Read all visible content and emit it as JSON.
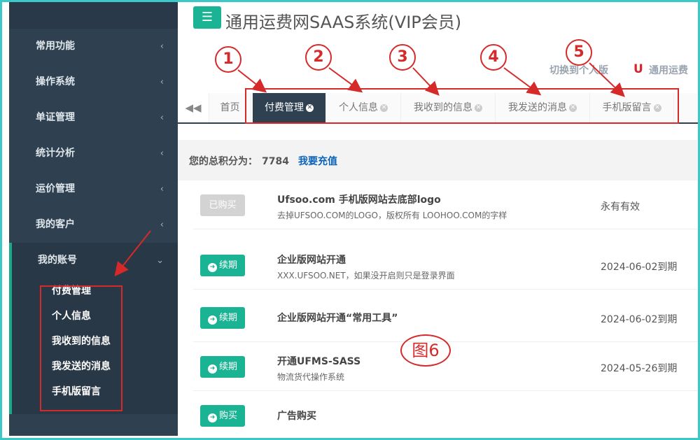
{
  "app": {
    "title": "通用运费网SAAS系统(VIP会员)",
    "switch_link": "切换到个人版",
    "general_link": "通用运费"
  },
  "sidebar": {
    "items": [
      {
        "label": "常用功能"
      },
      {
        "label": "操作系统"
      },
      {
        "label": "单证管理"
      },
      {
        "label": "统计分析"
      },
      {
        "label": "运价管理"
      },
      {
        "label": "我的客户"
      }
    ],
    "open_item": {
      "label": "我的账号"
    },
    "subitems": [
      {
        "label": "付费管理"
      },
      {
        "label": "个人信息"
      },
      {
        "label": "我收到的信息"
      },
      {
        "label": "我发送的消息"
      },
      {
        "label": "手机版留言"
      }
    ]
  },
  "tabs": {
    "home": "首页",
    "items": [
      {
        "label": "付费管理",
        "active": true
      },
      {
        "label": "个人信息",
        "active": false
      },
      {
        "label": "我收到的信息",
        "active": false
      },
      {
        "label": "我发送的消息",
        "active": false
      },
      {
        "label": "手机版留言",
        "active": false
      }
    ]
  },
  "annotations": {
    "numbers": [
      "1",
      "2",
      "3",
      "4",
      "5"
    ],
    "figure": "图6"
  },
  "content": {
    "points_label": "您的总积分为：",
    "points_value": "7784",
    "recharge": "我要充值",
    "rows": [
      {
        "button": "已购买",
        "button_icon": "",
        "title": "Ufsoo.com 手机版网站去底部logo",
        "desc": "去掉UFSOO.COM的LOGO，版权所有 LOOHOO.COM的字样",
        "date": "永有有效"
      },
      {
        "button": "续期",
        "button_icon": "arrow-right-circle-icon",
        "title": "企业版网站开通",
        "desc": "XXX.UFSOO.NET，如果没开启则只是登录界面",
        "date": "2024-06-02到期"
      },
      {
        "button": "续期",
        "button_icon": "arrow-right-circle-icon",
        "title": "企业版网站开通“常用工具”",
        "desc": "",
        "date": "2024-06-02到期"
      },
      {
        "button": "续期",
        "button_icon": "arrow-right-circle-icon",
        "title": "开通UFMS-SASS",
        "desc": "物流货代操作系统",
        "date": "2024-05-26到期"
      },
      {
        "button": "购买",
        "button_icon": "arrow-right-circle-icon",
        "title": "广告购买",
        "desc": "",
        "date": ""
      }
    ]
  },
  "colors": {
    "sidebar_bg": "#2f4050",
    "accent_green": "#1ab394",
    "annotation_red": "#d62a2a",
    "frame_teal": "#3cc8c8"
  }
}
